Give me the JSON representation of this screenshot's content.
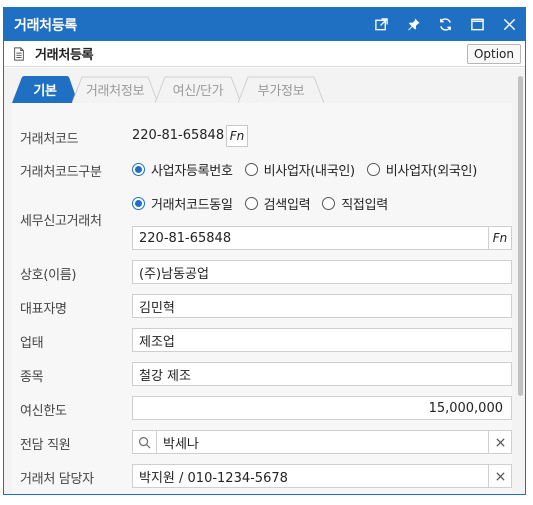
{
  "window": {
    "title": "거래처등록"
  },
  "toolbar": {
    "subtitle": "거래처등록",
    "option_label": "Option"
  },
  "tabs": [
    {
      "label": "기본"
    },
    {
      "label": "거래처정보"
    },
    {
      "label": "여신/단가"
    },
    {
      "label": "부가정보"
    }
  ],
  "form": {
    "code": {
      "label": "거래처코드",
      "value": "220-81-65848",
      "fn": "Fn"
    },
    "code_type": {
      "label": "거래처코드구분",
      "options": [
        "사업자등록번호",
        "비사업자(내국인)",
        "비사업자(외국인)"
      ],
      "selected": "사업자등록번호"
    },
    "tax_partner": {
      "label": "세무신고거래처",
      "options": [
        "거래처코드동일",
        "검색입력",
        "직접입력"
      ],
      "selected": "거래처코드동일",
      "value": "220-81-65848",
      "fn": "Fn"
    },
    "company_name": {
      "label": "상호(이름)",
      "value": "(주)남동공업"
    },
    "ceo_name": {
      "label": "대표자명",
      "value": "김민혁"
    },
    "business_type": {
      "label": "업태",
      "value": "제조업"
    },
    "business_item": {
      "label": "종목",
      "value": "철강 제조"
    },
    "credit_limit": {
      "label": "여신한도",
      "value": "15,000,000"
    },
    "employee": {
      "label": "전담 직원",
      "value": "박세나"
    },
    "contact": {
      "label": "거래처 담당자",
      "value": "박지원 / 010-1234-5678"
    }
  },
  "colors": {
    "accent": "#1f6fc2"
  },
  "icons": [
    "popout-icon",
    "pin-icon",
    "refresh-icon",
    "maximize-icon",
    "close-icon",
    "document-icon",
    "search-icon",
    "clear-icon"
  ]
}
